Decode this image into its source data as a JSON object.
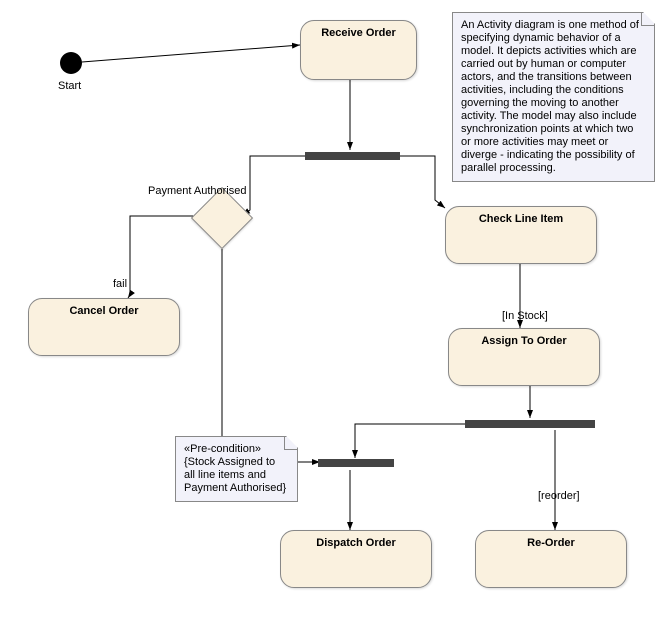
{
  "start_label": "Start",
  "activities": {
    "receive": "Receive Order",
    "check": "Check Line Item",
    "cancel": "Cancel Order",
    "assign": "Assign To Order",
    "dispatch": "Dispatch Order",
    "reorder": "Re-Order"
  },
  "guards": {
    "payment": "Payment Authorised",
    "fail": "fail",
    "instock": "[In Stock]",
    "reorder_g": "[reorder]"
  },
  "notes": {
    "main": "An Activity diagram is one method of specifying dynamic behavior of a model. It depicts activities which are carried out by human or computer actors, and the transitions between activities, including the conditions governing the moving to another activity. The model may also include synchronization points at which two or more activities may meet or diverge - indicating the possibility of parallel processing.",
    "pre_title": "«Pre-condition»",
    "pre_body": "{Stock Assigned to all line items and Payment Authorised}"
  }
}
